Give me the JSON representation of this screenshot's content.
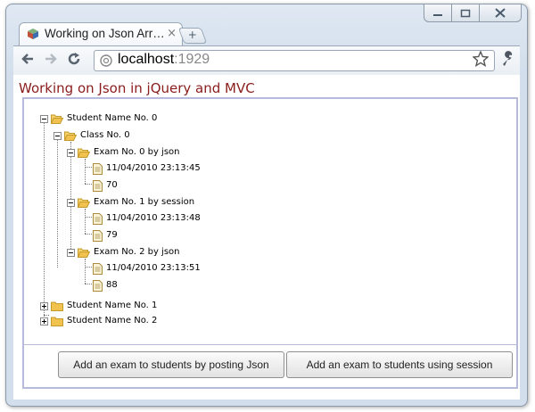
{
  "browser": {
    "tab_title": "Working on Json Arr…",
    "tab_close": "×",
    "new_tab": "+",
    "url_host": "localhost",
    "url_port": ":1929"
  },
  "page": {
    "title": "Working on Json in jQuery and MVC"
  },
  "tree": {
    "student0": "Student Name No. 0",
    "class0": "Class No. 0",
    "exam0": "Exam No. 0 by json",
    "exam0_date": "11/04/2010 23:13:45",
    "exam0_score": "70",
    "exam1": "Exam No. 1 by session",
    "exam1_date": "11/04/2010 23:13:48",
    "exam1_score": "79",
    "exam2": "Exam No. 2 by json",
    "exam2_date": "11/04/2010 23:13:51",
    "exam2_score": "88",
    "student1": "Student Name No. 1",
    "student2": "Student Name No. 2"
  },
  "buttons": {
    "post_json": "Add an exam to students by posting Json",
    "use_session": "Add an exam to students using session"
  },
  "colors": {
    "title": "#8a1c1c",
    "panel_border": "#b6bbdc",
    "folder": "#f1c24e"
  },
  "icons": {
    "favicon": "cube-icon",
    "back": "back-arrow-icon",
    "forward": "forward-arrow-icon",
    "reload": "reload-icon",
    "star": "star-icon",
    "wrench": "wrench-icon"
  }
}
